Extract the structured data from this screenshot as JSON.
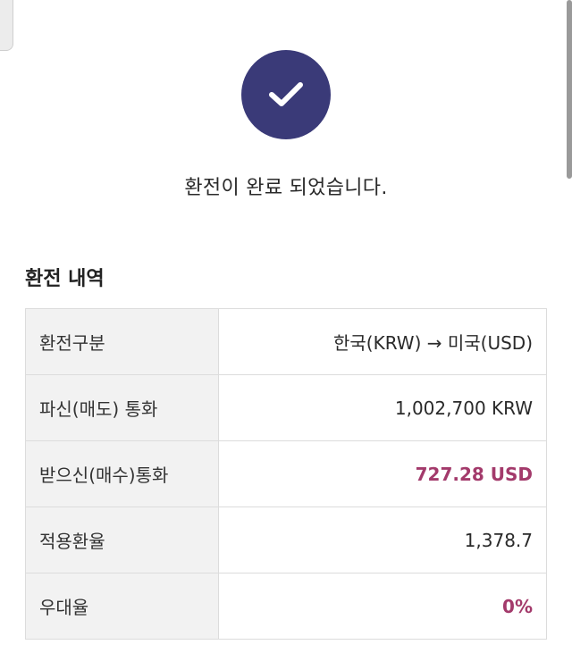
{
  "icons": {
    "check": "check-icon"
  },
  "colors": {
    "check_circle": "#3a3a78",
    "accent_value": "#a33a6b",
    "label_bg": "#f2f2f2",
    "border": "#dcdcdc"
  },
  "completion": {
    "message": "환전이 완료 되었습니다."
  },
  "details": {
    "title": "환전 내역",
    "rows": [
      {
        "label": "환전구분",
        "value": "한국(KRW) → 미국(USD)"
      },
      {
        "label": "파신(매도) 통화",
        "value": "1,002,700 KRW"
      },
      {
        "label": "받으신(매수)통화",
        "value": "727.28 USD"
      },
      {
        "label": "적용환율",
        "value": "1,378.7"
      },
      {
        "label": "우대율",
        "value": "0%"
      }
    ]
  }
}
